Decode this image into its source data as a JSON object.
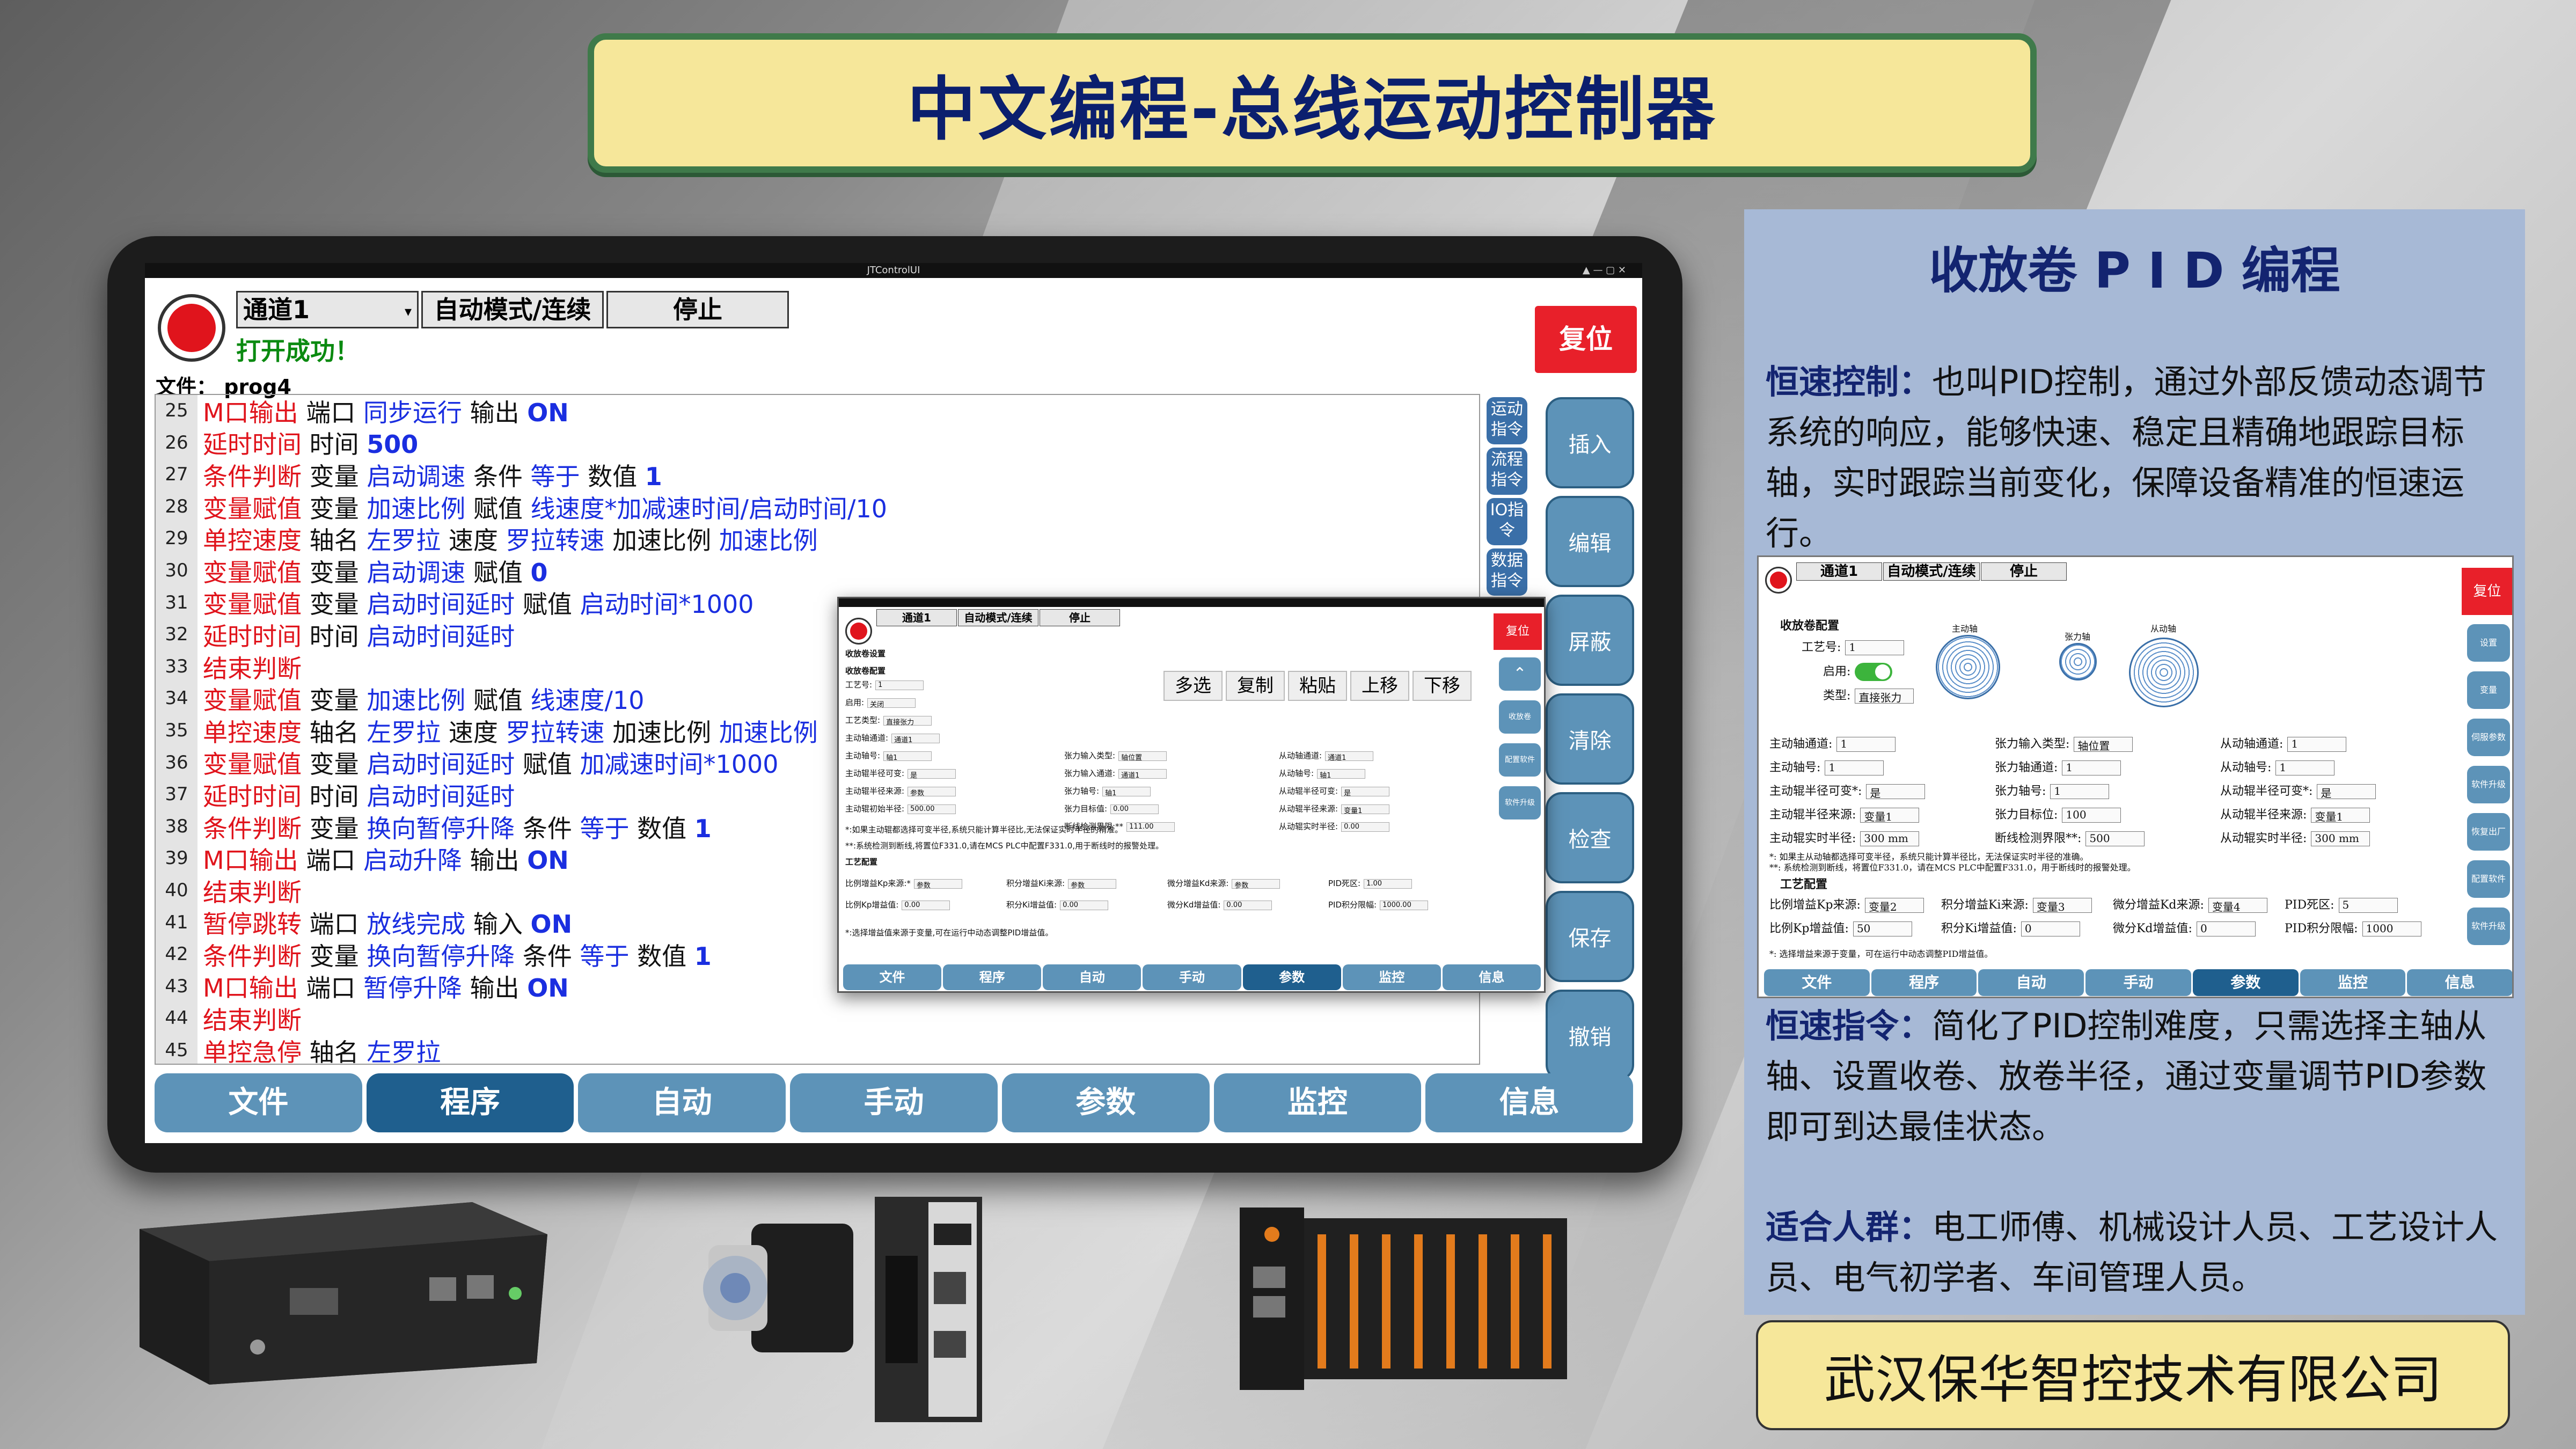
{
  "banner": {
    "title": "中文编程-总线运动控制器"
  },
  "app": {
    "window_title": "JTControlUI",
    "channel": "通道1",
    "mode": "自动模式/连续",
    "stop_label": "停止",
    "status": "打开成功！",
    "reset_label": "复位",
    "file_label": "文件：",
    "file_name": "prog4",
    "edit_tools": [
      "多选",
      "复制",
      "粘贴",
      "上移",
      "下移"
    ],
    "side_cmds": [
      "运动指令",
      "流程指令",
      "IO指令",
      "数据指令"
    ],
    "right_buttons": [
      "插入",
      "编辑",
      "屏蔽",
      "清除",
      "检查",
      "保存",
      "撤销"
    ],
    "tabs": [
      "文件",
      "程序",
      "自动",
      "手动",
      "参数",
      "监控",
      "信息"
    ],
    "active_tab": "程序"
  },
  "code_lines": [
    {
      "n": "25",
      "parts": [
        [
          "r",
          "M口输出"
        ],
        [
          "k",
          " 端口 "
        ],
        [
          "b",
          "同步运行"
        ],
        [
          "k",
          " 输出 "
        ],
        [
          "bb",
          "ON"
        ]
      ]
    },
    {
      "n": "26",
      "parts": [
        [
          "r",
          "延时时间"
        ],
        [
          "k",
          " 时间 "
        ],
        [
          "bb",
          "500"
        ]
      ]
    },
    {
      "n": "27",
      "parts": [
        [
          "r",
          "条件判断"
        ],
        [
          "k",
          " 变量 "
        ],
        [
          "b",
          "启动调速"
        ],
        [
          "k",
          " 条件 "
        ],
        [
          "b",
          "等于"
        ],
        [
          "k",
          " 数值 "
        ],
        [
          "bb",
          "1"
        ]
      ]
    },
    {
      "n": "28",
      "parts": [
        [
          "r",
          "变量赋值"
        ],
        [
          "k",
          " 变量 "
        ],
        [
          "b",
          "加速比例"
        ],
        [
          "k",
          " 赋值 "
        ],
        [
          "b",
          "线速度*加减速时间/启动时间/10"
        ]
      ]
    },
    {
      "n": "29",
      "parts": [
        [
          "r",
          "单控速度"
        ],
        [
          "k",
          " 轴名 "
        ],
        [
          "b",
          "左罗拉"
        ],
        [
          "k",
          " 速度 "
        ],
        [
          "b",
          "罗拉转速"
        ],
        [
          "k",
          " 加速比例 "
        ],
        [
          "b",
          "加速比例"
        ]
      ]
    },
    {
      "n": "30",
      "parts": [
        [
          "r",
          "变量赋值"
        ],
        [
          "k",
          " 变量 "
        ],
        [
          "b",
          "启动调速"
        ],
        [
          "k",
          " 赋值 "
        ],
        [
          "bb",
          "0"
        ]
      ]
    },
    {
      "n": "31",
      "parts": [
        [
          "r",
          "变量赋值"
        ],
        [
          "k",
          " 变量 "
        ],
        [
          "b",
          "启动时间延时"
        ],
        [
          "k",
          " 赋值 "
        ],
        [
          "b",
          "启动时间*1000"
        ]
      ]
    },
    {
      "n": "32",
      "parts": [
        [
          "r",
          "延时时间"
        ],
        [
          "k",
          " 时间 "
        ],
        [
          "b",
          "启动时间延时"
        ]
      ]
    },
    {
      "n": "33",
      "parts": [
        [
          "r",
          "结束判断"
        ]
      ]
    },
    {
      "n": "34",
      "parts": [
        [
          "r",
          "变量赋值"
        ],
        [
          "k",
          " 变量 "
        ],
        [
          "b",
          "加速比例"
        ],
        [
          "k",
          " 赋值 "
        ],
        [
          "b",
          "线速度/10"
        ]
      ]
    },
    {
      "n": "35",
      "parts": [
        [
          "r",
          "单控速度"
        ],
        [
          "k",
          " 轴名 "
        ],
        [
          "b",
          "左罗拉"
        ],
        [
          "k",
          " 速度 "
        ],
        [
          "b",
          "罗拉转速"
        ],
        [
          "k",
          " 加速比例 "
        ],
        [
          "b",
          "加速比例"
        ]
      ]
    },
    {
      "n": "36",
      "parts": [
        [
          "r",
          "变量赋值"
        ],
        [
          "k",
          " 变量 "
        ],
        [
          "b",
          "启动时间延时"
        ],
        [
          "k",
          " 赋值 "
        ],
        [
          "b",
          "加减速时间*1000"
        ]
      ]
    },
    {
      "n": "37",
      "parts": [
        [
          "r",
          "延时时间"
        ],
        [
          "k",
          " 时间 "
        ],
        [
          "b",
          "启动时间延时"
        ]
      ]
    },
    {
      "n": "38",
      "parts": [
        [
          "r",
          "条件判断"
        ],
        [
          "k",
          " 变量 "
        ],
        [
          "b",
          "换向暂停升降"
        ],
        [
          "k",
          " 条件 "
        ],
        [
          "b",
          "等于"
        ],
        [
          "k",
          " 数值 "
        ],
        [
          "bb",
          "1"
        ]
      ]
    },
    {
      "n": "39",
      "parts": [
        [
          "r",
          "M口输出"
        ],
        [
          "k",
          " 端口 "
        ],
        [
          "b",
          "启动升降"
        ],
        [
          "k",
          " 输出 "
        ],
        [
          "bb",
          "ON"
        ]
      ]
    },
    {
      "n": "40",
      "parts": [
        [
          "r",
          "结束判断"
        ]
      ]
    },
    {
      "n": "41",
      "parts": [
        [
          "r",
          "暂停跳转"
        ],
        [
          "k",
          " 端口 "
        ],
        [
          "b",
          "放线完成"
        ],
        [
          "k",
          " 输入 "
        ],
        [
          "bb",
          "ON"
        ]
      ]
    },
    {
      "n": "42",
      "parts": [
        [
          "r",
          "条件判断"
        ],
        [
          "k",
          " 变量 "
        ],
        [
          "b",
          "换向暂停升降"
        ],
        [
          "k",
          " 条件 "
        ],
        [
          "b",
          "等于"
        ],
        [
          "k",
          " 数值 "
        ],
        [
          "bb",
          "1"
        ]
      ]
    },
    {
      "n": "43",
      "parts": [
        [
          "r",
          "M口输出"
        ],
        [
          "k",
          " 端口 "
        ],
        [
          "b",
          "暂停升降"
        ],
        [
          "k",
          " 输出 "
        ],
        [
          "bb",
          "ON"
        ]
      ]
    },
    {
      "n": "44",
      "parts": [
        [
          "r",
          "结束判断"
        ]
      ]
    },
    {
      "n": "45",
      "parts": [
        [
          "r",
          "单控急停"
        ],
        [
          "k",
          " 轴名 "
        ],
        [
          "b",
          "左罗拉"
        ]
      ]
    }
  ],
  "mini": {
    "channel": "通道1",
    "mode": "自动模式/连续",
    "stop": "停止",
    "reset": "复位",
    "section1": "收放卷设置",
    "section2": "收放卷配置",
    "section3": "工艺配置",
    "rows": [
      [
        "工艺号:",
        "1"
      ],
      [
        "启用:",
        "关闭"
      ],
      [
        "工艺类型:",
        "直接张力"
      ],
      [
        "主动轴通道:",
        "通道1"
      ],
      [
        "主动轴号:",
        "轴1"
      ],
      [
        "主动辊半径可变:",
        "是"
      ],
      [
        "主动辊半径来源:",
        "参数"
      ],
      [
        "主动辊初始半径:",
        "500.00"
      ]
    ],
    "rows_mid": [
      [
        "张力输入类型:",
        "轴位置"
      ],
      [
        "张力输入通道:",
        "通道1"
      ],
      [
        "张力轴号:",
        "轴1"
      ],
      [
        "张力目标值:",
        "0.00"
      ],
      [
        "断线检测界限:**",
        "111.00"
      ]
    ],
    "rows_right": [
      [
        "从动轴通道:",
        "通道1"
      ],
      [
        "从动轴号:",
        "轴1"
      ],
      [
        "从动辊半径可变:",
        "是"
      ],
      [
        "从动辊半径来源:",
        "变量1"
      ],
      [
        "从动辊实时半径:",
        "0.00"
      ]
    ],
    "note1": "*:如果主动辊都选择可变半径,系统只能计算半径比,无法保证实时半径的精准。",
    "note2": "**:系统检测到断线,将置位F331.0,请在MCS PLC中配置F331.0,用于断线时的报警处理。",
    "pid": [
      [
        "比例增益Kp来源:*",
        "参数"
      ],
      [
        "积分增益Ki来源:",
        "参数"
      ],
      [
        "微分增益Kd来源:",
        "参数"
      ],
      [
        "PID死区:",
        "1.00"
      ],
      [
        "比例Kp增益值:",
        "0.00"
      ],
      [
        "积分Ki增益值:",
        "0.00"
      ],
      [
        "微分Kd增益值:",
        "0.00"
      ],
      [
        "PID积分限幅:",
        "1000.00"
      ]
    ],
    "note3": "*:选择增益值来源于变量,可在运行中动态调整PID增益值。",
    "side": [
      "收放卷",
      "配置软件",
      "软件升级"
    ],
    "tabs": [
      "文件",
      "程序",
      "自动",
      "手动",
      "参数",
      "监控",
      "信息"
    ],
    "active_tab": "参数"
  },
  "panel": {
    "title": "收放卷 P I D 编程",
    "p1_head": "恒速控制：",
    "p1_body": "也叫PID控制，通过外部反馈动态调节系统的响应，能够快速、稳定且精确地跟踪目标轴，实时跟踪当前变化，保障设备精准的恒速运行。",
    "p2_head": "恒速指令：",
    "p2_body": "简化了PID控制难度，只需选择主轴从轴、设置收卷、放卷半径，通过变量调节PID参数即可到达最佳状态。",
    "p3_head": "适合人群：",
    "p3_body": "电工师傅、机械设计人员、工艺设计人员、电气初学者、车间管理人员。",
    "shot": {
      "channel": "通道1",
      "mode": "自动模式/连续",
      "stop": "停止",
      "reset": "复位",
      "section1": "收放卷配置",
      "section2": "工艺配置",
      "craft_no": [
        "工艺号:",
        "1"
      ],
      "enable": "启用:",
      "type": [
        "类型:",
        "直接张力"
      ],
      "left_rows": [
        [
          "主动轴通道:",
          "1"
        ],
        [
          "主动轴号:",
          "1"
        ],
        [
          "主动辊半径可变*:",
          "是"
        ],
        [
          "主动辊半径来源:",
          "变量1"
        ],
        [
          "主动辊实时半径:",
          "300 mm"
        ]
      ],
      "mid_rows": [
        [
          "张力输入类型:",
          "轴位置"
        ],
        [
          "张力轴通道:",
          "1"
        ],
        [
          "张力轴号:",
          "1"
        ],
        [
          "张力目标位:",
          "100"
        ],
        [
          "断线检测界限**:",
          "500"
        ]
      ],
      "right_rows": [
        [
          "从动轴通道:",
          "1"
        ],
        [
          "从动轴号:",
          "1"
        ],
        [
          "从动辊半径可变*:",
          "是"
        ],
        [
          "从动辊半径来源:",
          "变量1"
        ],
        [
          "从动辊实时半径:",
          "300 mm"
        ]
      ],
      "note": "*: 如果主从动轴都选择可变半径，系统只能计算半径比，无法保证实时半径的准确。",
      "note2": "**: 系统检测到断线，将置位F331.0，请在MCS PLC中配置F331.0，用于断线时的报警处理。",
      "pid_rows": [
        [
          "比例增益Kp来源:",
          "变量2"
        ],
        [
          "积分增益Ki来源:",
          "变量3"
        ],
        [
          "微分增益Kd来源:",
          "变量4"
        ],
        [
          "PID死区:",
          "5"
        ],
        [
          "比例Kp增益值:",
          "50"
        ],
        [
          "积分Ki增益值:",
          "0"
        ],
        [
          "微分Kd增益值:",
          "0"
        ],
        [
          "PID积分限幅:",
          "1000"
        ]
      ],
      "note3": "*: 选择增益来源于变量，可在运行中动态调整PID增益值。",
      "diagram_labels": [
        "主动轴",
        "张力轴",
        "从动轴"
      ],
      "side": [
        "设置",
        "变量",
        "伺服参数",
        "软件升级",
        "恢复出厂",
        "配置软件",
        "软件升级"
      ],
      "tabs": [
        "文件",
        "程序",
        "自动",
        "手动",
        "参数",
        "监控",
        "信息"
      ],
      "active_tab": "参数"
    }
  },
  "company": {
    "name": "武汉保华智控技术有限公司"
  }
}
